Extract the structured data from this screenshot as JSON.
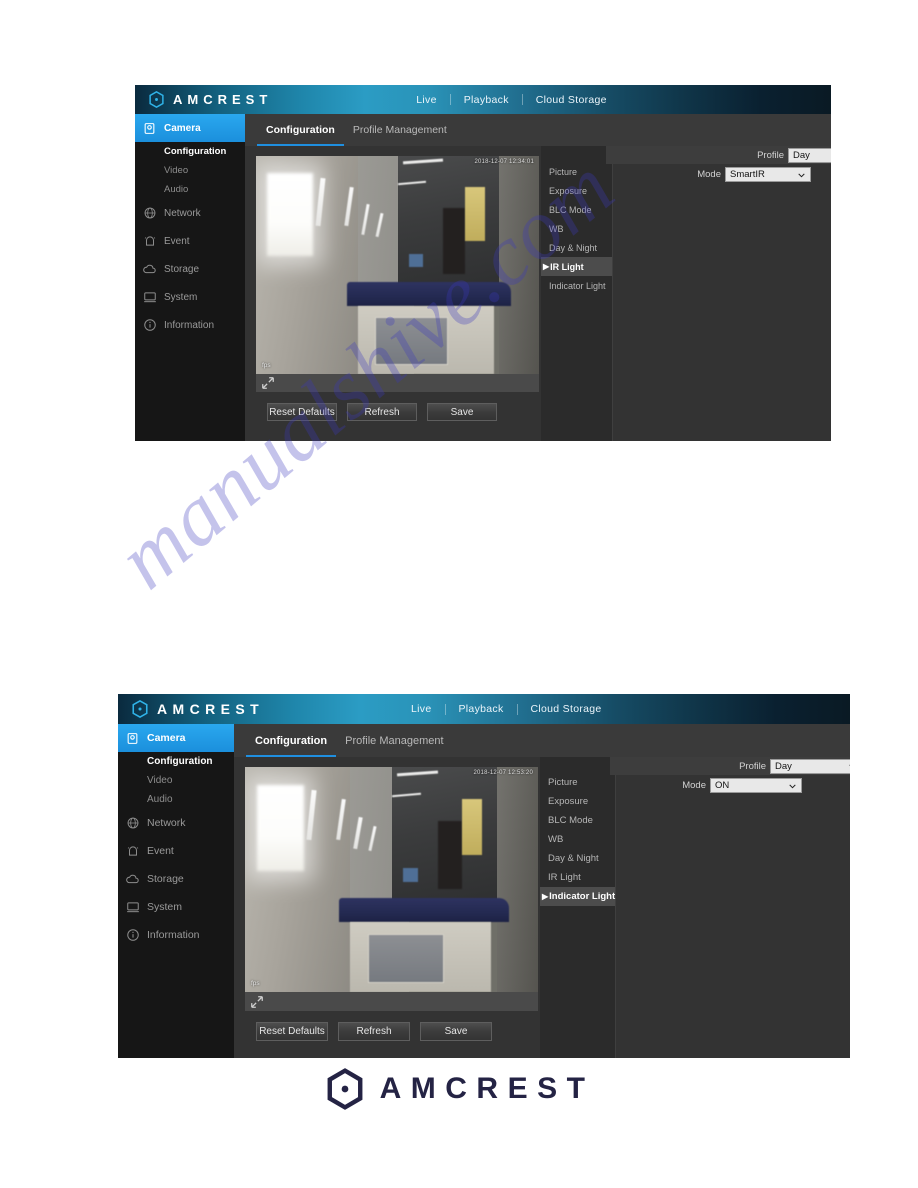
{
  "brand": {
    "name": "AMCREST",
    "logo_icon": "amcrest-hexagon-logo-icon"
  },
  "footer": {
    "name": "AMCREST",
    "logo_icon": "amcrest-hexagon-logo-icon"
  },
  "watermark": {
    "text": "manualshive.com",
    "color": "#3c37be"
  },
  "topnav": {
    "items": [
      {
        "label": "Live"
      },
      {
        "label": "Playback"
      },
      {
        "label": "Cloud Storage"
      }
    ]
  },
  "sidebar": {
    "items": [
      {
        "label": "Camera",
        "icon": "camera-icon",
        "active": true
      },
      {
        "label": "Network",
        "icon": "network-globe-icon",
        "active": false
      },
      {
        "label": "Event",
        "icon": "event-alarm-icon",
        "active": false
      },
      {
        "label": "Storage",
        "icon": "storage-cloud-icon",
        "active": false
      },
      {
        "label": "System",
        "icon": "system-monitor-icon",
        "active": false
      },
      {
        "label": "Information",
        "icon": "information-circle-icon",
        "active": false
      }
    ],
    "camera_children": [
      {
        "label": "Configuration",
        "selected": true
      },
      {
        "label": "Video",
        "selected": false
      },
      {
        "label": "Audio",
        "selected": false
      }
    ]
  },
  "tabs": [
    {
      "label": "Configuration",
      "active": true
    },
    {
      "label": "Profile Management",
      "active": false
    }
  ],
  "settings_menu": [
    {
      "label": "Picture"
    },
    {
      "label": "Exposure"
    },
    {
      "label": "BLC Mode"
    },
    {
      "label": "WB"
    },
    {
      "label": "Day & Night"
    },
    {
      "label": "IR Light"
    },
    {
      "label": "Indicator Light"
    }
  ],
  "buttons": {
    "reset_defaults": "Reset Defaults",
    "refresh": "Refresh",
    "save": "Save"
  },
  "video": {
    "timestamp": "2018-12-07 12:34:01",
    "fps_label": "fps",
    "expand_icon": "expand-arrows-icon"
  },
  "screen_one": {
    "selected_menu": "IR Light",
    "caret": "▶",
    "profile": {
      "label": "Profile",
      "value": "Day"
    },
    "mode": {
      "label": "Mode",
      "value": "SmartIR"
    },
    "video_timestamp": "2018-12-07 12:34:01"
  },
  "screen_two": {
    "selected_menu": "Indicator Light",
    "caret": "▶",
    "profile": {
      "label": "Profile",
      "value": "Day"
    },
    "mode": {
      "label": "Mode",
      "value": "ON"
    },
    "video_timestamp": "2018-12-07 12:53:20"
  },
  "colors": {
    "accent_blue": "#2299e4",
    "tab_underline": "#1f8fe0",
    "panel_dark": "#2b2b2b",
    "sidebar_dark": "#161616",
    "logo_navy": "#242344"
  }
}
